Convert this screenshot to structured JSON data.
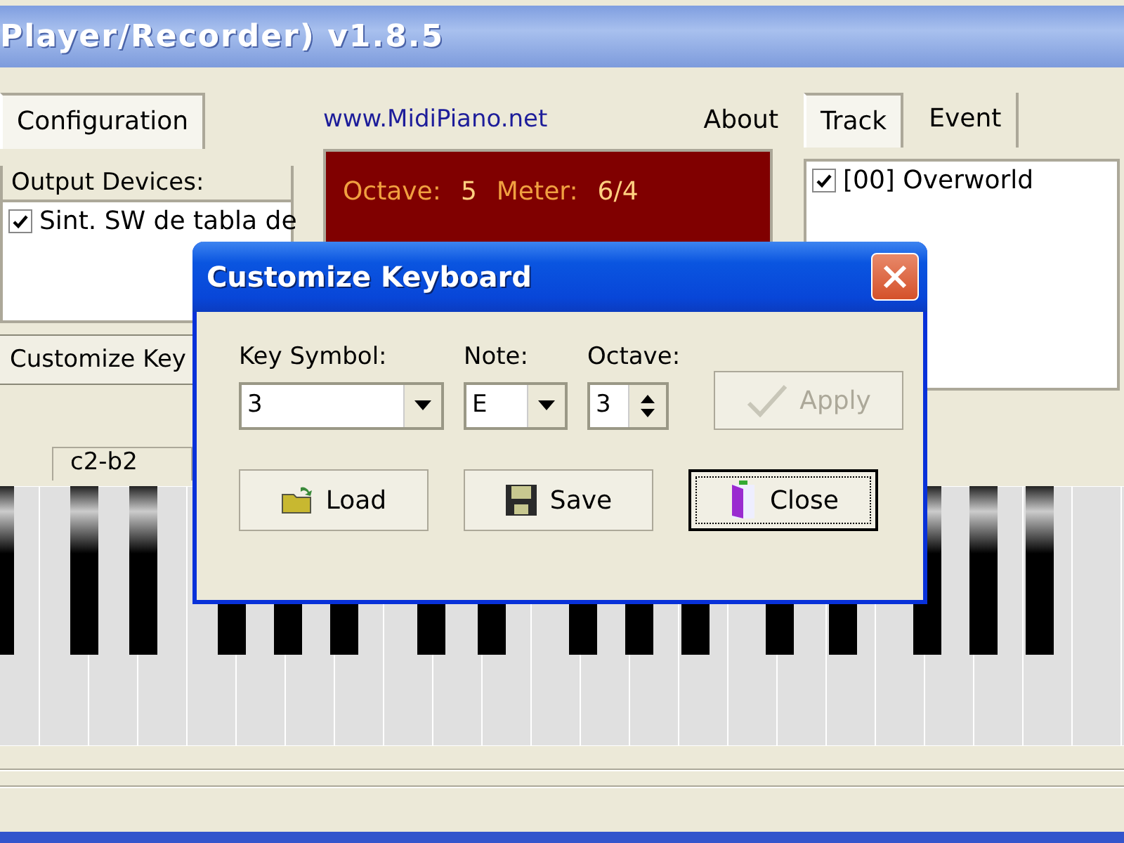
{
  "main_window": {
    "title": "Player/Recorder) v1.8.5",
    "left_tabs": [
      {
        "label": "Configuration",
        "selected": true
      }
    ],
    "link": "www.MidiPiano.net",
    "about": "About",
    "right_tabs": [
      {
        "label": "Track",
        "selected": true
      },
      {
        "label": "Event",
        "selected": false
      }
    ],
    "output_devices": {
      "title": "Output Devices:",
      "items": [
        {
          "label": "Sint. SW de tabla de",
          "checked": true
        }
      ]
    },
    "display": {
      "octave_label": "Octave:",
      "octave": "5",
      "meter_label": "Meter:",
      "meter": "6/4"
    },
    "tracks": [
      {
        "label": "[00] Overworld",
        "checked": true
      }
    ],
    "customize_button": "Customize Key",
    "range_label": "c2-b2"
  },
  "dialog": {
    "title": "Customize Keyboard",
    "fields": [
      {
        "label": "Key Symbol:",
        "kind": "combo",
        "value": "3"
      },
      {
        "label": "Note:",
        "kind": "combo",
        "value": "E"
      },
      {
        "label": "Octave:",
        "kind": "spin",
        "value": "3"
      }
    ],
    "apply": {
      "label": "Apply",
      "disabled": true
    },
    "buttons": [
      {
        "label": "Load",
        "kind": "load",
        "focused": false
      },
      {
        "label": "Save",
        "kind": "save",
        "focused": false
      },
      {
        "label": "Close",
        "kind": "close",
        "focused": true
      }
    ]
  }
}
